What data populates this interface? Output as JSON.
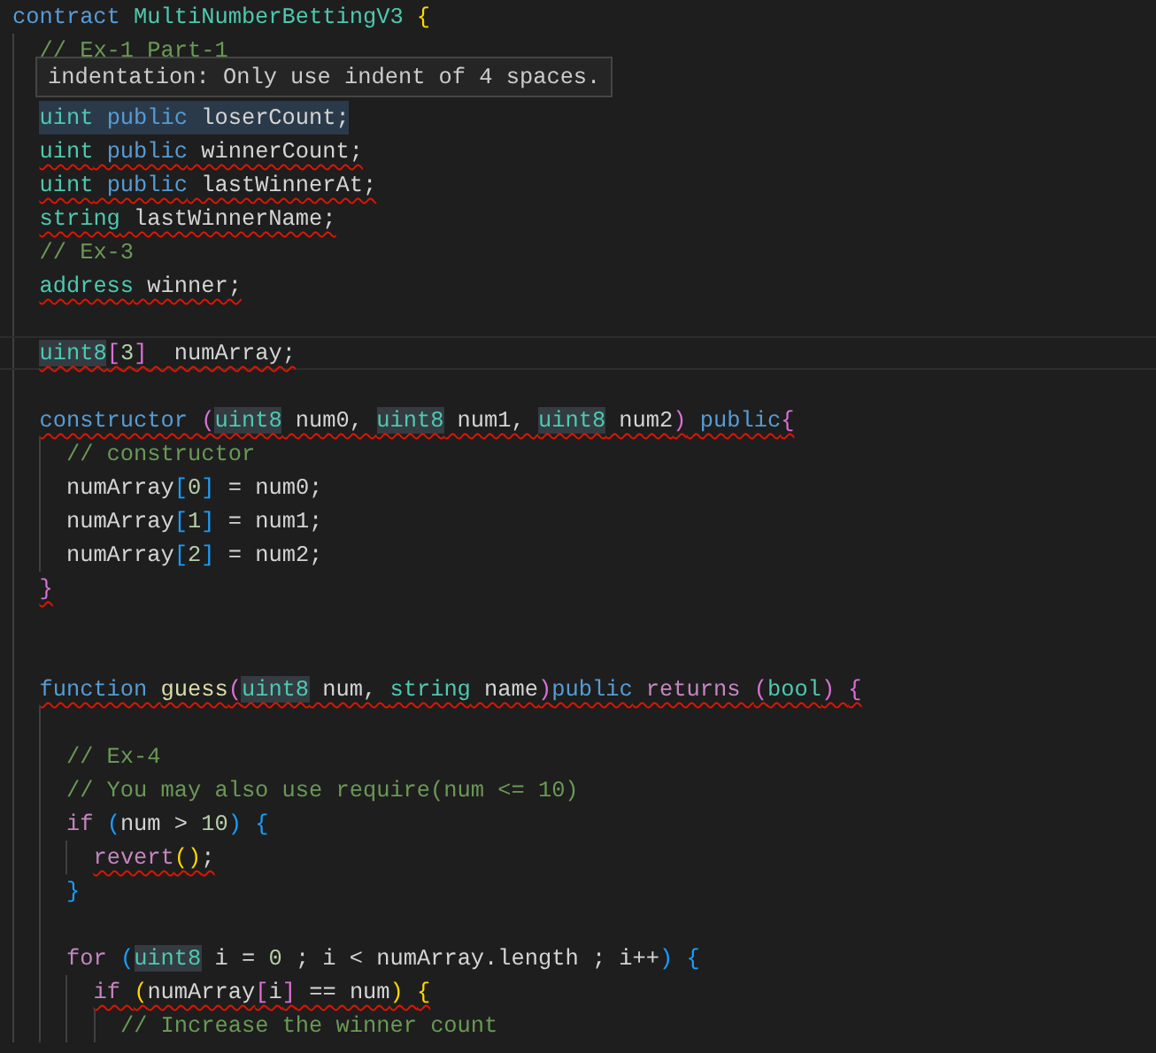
{
  "editor": {
    "tooltip": "indentation: Only use indent of 4 spaces.",
    "lines": [
      {
        "selected": false,
        "tokens": [
          {
            "text": "contract ",
            "kind": "kw"
          },
          {
            "text": "MultiNumberBettingV3 ",
            "kind": "type"
          },
          {
            "text": "{",
            "kind": "bracket1"
          }
        ],
        "children": [
          {
            "selected": false,
            "tokens": [
              {
                "text": "// Ex-1 Part-1",
                "kind": "comment"
              }
            ]
          },
          {
            "selected": false
          },
          {
            "selected": true,
            "tokens": [
              {
                "text": "uint",
                "kind": "type"
              },
              {
                "text": " public",
                "kind": "kw"
              },
              {
                "text": " loserCount;",
                "kind": "plain"
              }
            ]
          },
          {
            "selected": false,
            "tokens": [
              {
                "text": "uint",
                "kind": "type",
                "error": true
              },
              {
                "text": " public",
                "kind": "kw",
                "error": true
              },
              {
                "text": " winnerCount;",
                "kind": "plain",
                "error": true
              }
            ]
          },
          {
            "selected": false,
            "tokens": [
              {
                "text": "uint",
                "kind": "type",
                "error": true
              },
              {
                "text": " public",
                "kind": "kw",
                "error": true
              },
              {
                "text": " lastWinnerAt;",
                "kind": "plain",
                "error": true
              }
            ]
          },
          {
            "selected": false,
            "tokens": [
              {
                "text": "string",
                "kind": "type",
                "error": true
              },
              {
                "text": " lastWinnerName;",
                "kind": "plain",
                "error": true
              }
            ]
          },
          {
            "selected": false,
            "tokens": [
              {
                "text": "// Ex-3",
                "kind": "comment"
              }
            ]
          },
          {
            "selected": false,
            "tokens": [
              {
                "text": "address",
                "kind": "type",
                "error": true
              },
              {
                "text": " winner;",
                "kind": "plain",
                "error": true
              }
            ]
          },
          {
            "selected": false
          },
          {
            "selected": false,
            "current": true,
            "tokens": [
              {
                "text": "uint8",
                "kind": "type",
                "error": true,
                "highlight": true
              },
              {
                "text": "[",
                "kind": "bracket2",
                "error": true
              },
              {
                "text": "3",
                "kind": "num",
                "error": true
              },
              {
                "text": "]",
                "kind": "bracket2",
                "error": true
              },
              {
                "text": "  numArray;",
                "kind": "plain",
                "error": true
              }
            ]
          },
          {
            "selected": false
          },
          {
            "selected": false,
            "tokens": [
              {
                "text": "constructor ",
                "kind": "kw",
                "error": true
              },
              {
                "text": "(",
                "kind": "bracket2",
                "error": true
              },
              {
                "text": "uint8",
                "kind": "type",
                "error": true,
                "highlight": true
              },
              {
                "text": " num0, ",
                "kind": "plain",
                "error": true
              },
              {
                "text": "uint8",
                "kind": "type",
                "error": true,
                "highlight": true
              },
              {
                "text": " num1, ",
                "kind": "plain",
                "error": true
              },
              {
                "text": "uint8",
                "kind": "type",
                "error": true,
                "highlight": true
              },
              {
                "text": " num2",
                "kind": "plain",
                "error": true
              },
              {
                "text": ")",
                "kind": "bracket2",
                "error": true
              },
              {
                "text": " public",
                "kind": "kw",
                "error": true
              },
              {
                "text": "{",
                "kind": "bracket2",
                "error": true
              }
            ],
            "children": [
              {
                "selected": false,
                "tokens": [
                  {
                    "text": "// constructor",
                    "kind": "comment"
                  }
                ]
              },
              {
                "selected": false,
                "tokens": [
                  {
                    "text": "numArray",
                    "kind": "plain"
                  },
                  {
                    "text": "[",
                    "kind": "bracket3"
                  },
                  {
                    "text": "0",
                    "kind": "num"
                  },
                  {
                    "text": "]",
                    "kind": "bracket3"
                  },
                  {
                    "text": " = num0;",
                    "kind": "plain"
                  }
                ]
              },
              {
                "selected": false,
                "tokens": [
                  {
                    "text": "numArray",
                    "kind": "plain"
                  },
                  {
                    "text": "[",
                    "kind": "bracket3"
                  },
                  {
                    "text": "1",
                    "kind": "num"
                  },
                  {
                    "text": "]",
                    "kind": "bracket3"
                  },
                  {
                    "text": " = num1;",
                    "kind": "plain"
                  }
                ]
              },
              {
                "selected": false,
                "tokens": [
                  {
                    "text": "numArray",
                    "kind": "plain"
                  },
                  {
                    "text": "[",
                    "kind": "bracket3"
                  },
                  {
                    "text": "2",
                    "kind": "num"
                  },
                  {
                    "text": "]",
                    "kind": "bracket3"
                  },
                  {
                    "text": " = num2;",
                    "kind": "plain"
                  }
                ]
              }
            ]
          },
          {
            "selected": false,
            "tokens": [
              {
                "text": "}",
                "kind": "bracket2",
                "error": true
              }
            ]
          },
          {
            "selected": false
          },
          {
            "selected": false
          },
          {
            "selected": false,
            "tokens": [
              {
                "text": "function ",
                "kind": "kw",
                "error": true
              },
              {
                "text": "guess",
                "kind": "fn",
                "error": true
              },
              {
                "text": "(",
                "kind": "bracket2",
                "error": true
              },
              {
                "text": "uint8",
                "kind": "type",
                "error": true,
                "highlight": true
              },
              {
                "text": " num, ",
                "kind": "plain",
                "error": true
              },
              {
                "text": "string",
                "kind": "type",
                "error": true
              },
              {
                "text": " name",
                "kind": "plain",
                "error": true
              },
              {
                "text": ")",
                "kind": "bracket2",
                "error": true
              },
              {
                "text": "public",
                "kind": "kw",
                "error": true
              },
              {
                "text": " returns ",
                "kind": "ctrl",
                "error": true
              },
              {
                "text": "(",
                "kind": "bracket2",
                "error": true
              },
              {
                "text": "bool",
                "kind": "type",
                "error": true
              },
              {
                "text": ") ",
                "kind": "bracket2",
                "error": true
              },
              {
                "text": "{",
                "kind": "bracket2",
                "error": true
              }
            ],
            "children": [
              {
                "selected": false
              },
              {
                "selected": false,
                "tokens": [
                  {
                    "text": "// Ex-4",
                    "kind": "comment"
                  }
                ]
              },
              {
                "selected": false,
                "tokens": [
                  {
                    "text": "// You may also use require(num <= 10)",
                    "kind": "comment"
                  }
                ]
              },
              {
                "selected": false,
                "tokens": [
                  {
                    "text": "if ",
                    "kind": "ctrl"
                  },
                  {
                    "text": "(",
                    "kind": "bracket3"
                  },
                  {
                    "text": "num > ",
                    "kind": "plain"
                  },
                  {
                    "text": "10",
                    "kind": "num"
                  },
                  {
                    "text": ") ",
                    "kind": "bracket3"
                  },
                  {
                    "text": "{",
                    "kind": "bracket3"
                  }
                ],
                "children": [
                  {
                    "selected": false,
                    "tokens": [
                      {
                        "text": "revert",
                        "kind": "ctrl",
                        "error": true
                      },
                      {
                        "text": "(",
                        "kind": "bracket1",
                        "error": true
                      },
                      {
                        "text": ")",
                        "kind": "bracket1",
                        "error": true
                      },
                      {
                        "text": ";",
                        "kind": "plain",
                        "error": true
                      }
                    ]
                  }
                ]
              },
              {
                "selected": false,
                "tokens": [
                  {
                    "text": "}",
                    "kind": "bracket3"
                  }
                ]
              },
              {
                "selected": false
              },
              {
                "selected": false,
                "tokens": [
                  {
                    "text": "for ",
                    "kind": "ctrl"
                  },
                  {
                    "text": "(",
                    "kind": "bracket3"
                  },
                  {
                    "text": "uint8",
                    "kind": "type",
                    "highlight": true
                  },
                  {
                    "text": " i = ",
                    "kind": "plain"
                  },
                  {
                    "text": "0",
                    "kind": "num"
                  },
                  {
                    "text": " ; i < numArray.length ; i++",
                    "kind": "plain"
                  },
                  {
                    "text": ") ",
                    "kind": "bracket3"
                  },
                  {
                    "text": "{",
                    "kind": "bracket3"
                  }
                ],
                "children": [
                  {
                    "selected": false,
                    "tokens": [
                      {
                        "text": "if ",
                        "kind": "ctrl",
                        "error": true
                      },
                      {
                        "text": "(",
                        "kind": "bracket1",
                        "error": true
                      },
                      {
                        "text": "numArray",
                        "kind": "plain",
                        "error": true
                      },
                      {
                        "text": "[",
                        "kind": "bracket2",
                        "error": true
                      },
                      {
                        "text": "i",
                        "kind": "plain",
                        "error": true
                      },
                      {
                        "text": "]",
                        "kind": "bracket2",
                        "error": true
                      },
                      {
                        "text": " == num",
                        "kind": "plain",
                        "error": true
                      },
                      {
                        "text": ") ",
                        "kind": "bracket1",
                        "error": true
                      },
                      {
                        "text": "{",
                        "kind": "bracket1",
                        "error": true
                      }
                    ],
                    "children": [
                      {
                        "selected": false,
                        "tokens": [
                          {
                            "text": "// Increase the winner count",
                            "kind": "comment"
                          }
                        ]
                      }
                    ]
                  }
                ]
              }
            ]
          }
        ]
      }
    ]
  }
}
